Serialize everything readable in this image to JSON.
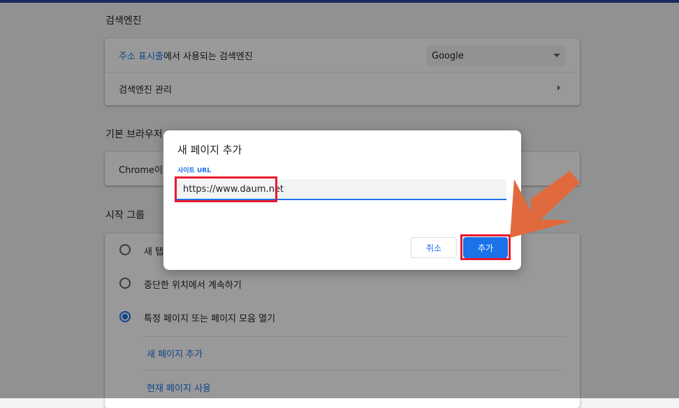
{
  "search_engine": {
    "section_title": "검색엔진",
    "address_bar_link": "주소 표시줄",
    "address_bar_rest": "에서 사용되는 검색엔진",
    "selected_engine": "Google",
    "manage_label": "검색엔진 관리"
  },
  "default_browser": {
    "section_title": "기본 브라우저",
    "row_text": "Chrome이 기본 브라우저입니다"
  },
  "startup": {
    "section_title": "시작 그룹",
    "options": [
      {
        "label": "새 탭 페이지 열기",
        "checked": false
      },
      {
        "label": "중단한 위치에서 계속하기",
        "checked": false
      },
      {
        "label": "특정 페이지 또는 페이지 모음 열기",
        "checked": true
      }
    ],
    "add_page_link": "새 페이지 추가",
    "use_current_link": "현재 페이지 사용"
  },
  "dialog": {
    "title": "새 페이지 추가",
    "field_label": "사이트 URL",
    "url_value": "https://www.daum.net",
    "cancel_label": "취소",
    "add_label": "추가"
  },
  "colors": {
    "accent": "#1a73e8",
    "highlight": "#e8192c",
    "annotation_arrow": "#e06a3d"
  },
  "icons": {
    "dropdown": "caret-down-icon",
    "chevron": "chevron-right-icon",
    "arrow": "annotation-arrow-icon"
  }
}
